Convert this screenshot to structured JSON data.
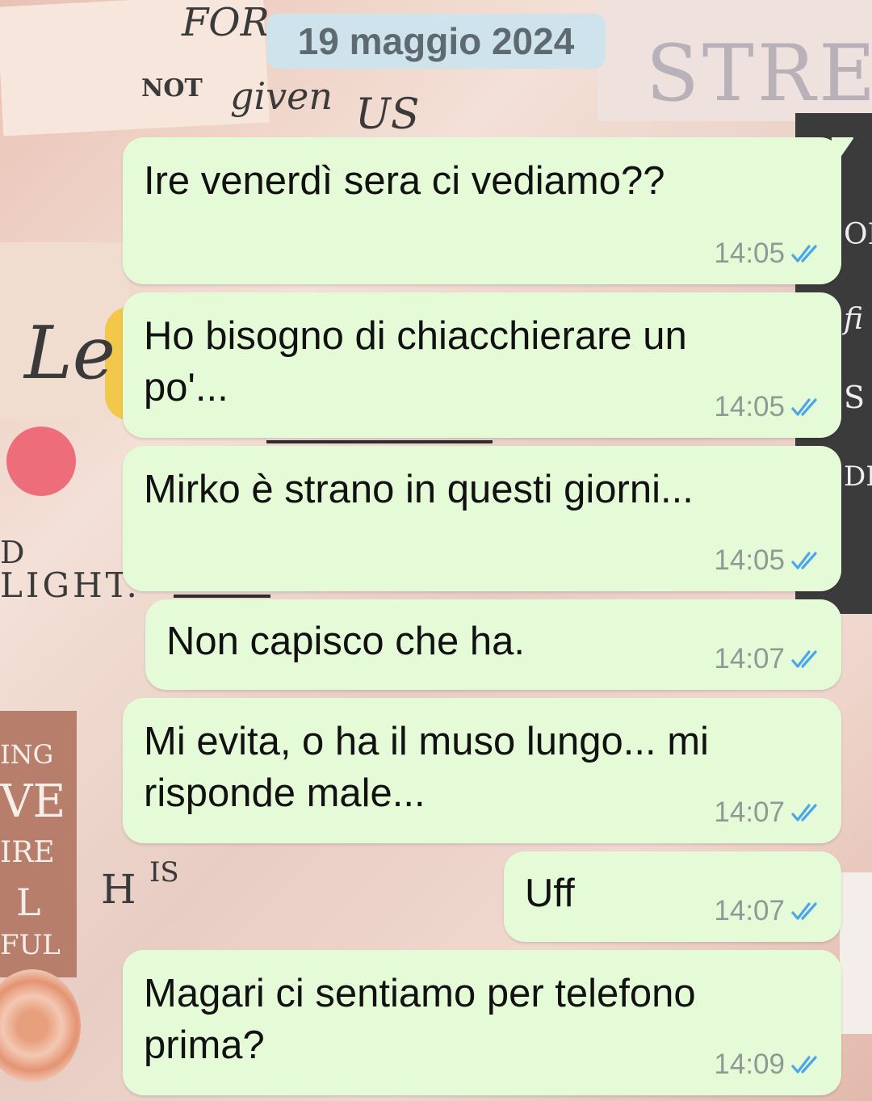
{
  "chat": {
    "date_label": "19 maggio 2024",
    "messages": [
      {
        "text": "Ire venerdì sera ci vediamo??",
        "time": "14:05",
        "status_icon": "read-double-check-icon"
      },
      {
        "text": "Ho bisogno di chiacchierare un\npo'...",
        "time": "14:05",
        "status_icon": "read-double-check-icon"
      },
      {
        "text": "Mirko è strano in questi giorni...",
        "time": "14:05",
        "status_icon": "read-double-check-icon"
      },
      {
        "text": "Non capisco che ha.",
        "time": "14:07",
        "status_icon": "read-double-check-icon"
      },
      {
        "text": "Mi evita, o ha il muso lungo... mi\nrisponde male...",
        "time": "14:07",
        "status_icon": "read-double-check-icon"
      },
      {
        "text": "Uff",
        "time": "14:07",
        "status_icon": "read-double-check-icon"
      },
      {
        "text": "Magari ci sentiamo per telefono\nprima?",
        "time": "14:09",
        "status_icon": "read-double-check-icon"
      }
    ]
  },
  "wallpaper": {
    "text_fragments": [
      "FOR",
      "NOT",
      "given",
      "US",
      "STRENG",
      "Le",
      "D",
      "LIGHT.",
      "ING",
      "VE",
      "IRE",
      "L",
      "FUL",
      "H",
      "IS",
      "OI",
      "fi",
      "S",
      "DI"
    ]
  },
  "colors": {
    "bubble_background": "#e5fbd7",
    "date_chip_background": "#cfe3ec",
    "read_tick": "#4aa6e8",
    "time_text": "#8f9a94"
  }
}
